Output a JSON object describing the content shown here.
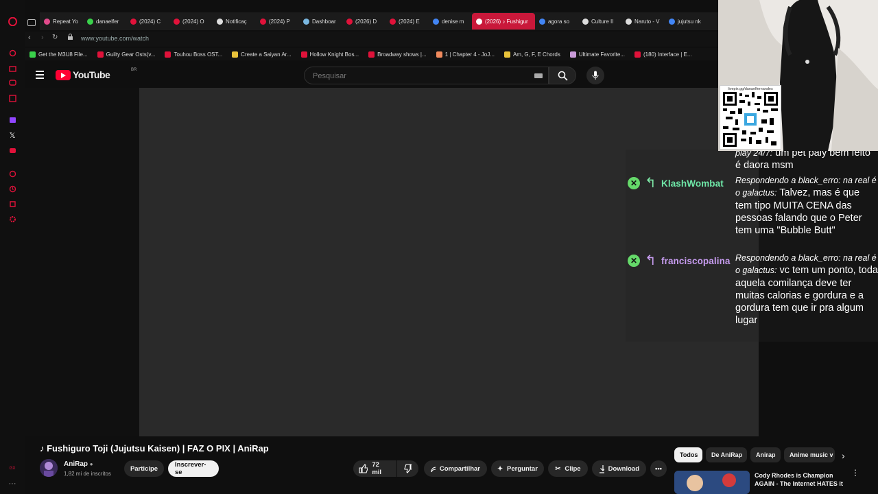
{
  "tabs": [
    {
      "label": "Repeat Yo",
      "color": "#e34b8c"
    },
    {
      "label": "danaelfer",
      "color": "#3ad14b"
    },
    {
      "label": "(2024) C",
      "color": "#e0123a"
    },
    {
      "label": "(2024) O",
      "color": "#e0123a"
    },
    {
      "label": "Notificaç",
      "color": "#dddddd"
    },
    {
      "label": "(2024) P",
      "color": "#e0123a"
    },
    {
      "label": "Dashboar",
      "color": "#7ab7e0"
    },
    {
      "label": "(2026) D",
      "color": "#e0123a"
    },
    {
      "label": "(2024) E",
      "color": "#e0123a"
    },
    {
      "label": "denise m",
      "color": "#4285f4"
    },
    {
      "label": "(2026) ♪ Fushigur",
      "color": "#ffffff",
      "active": true
    },
    {
      "label": "agora so",
      "color": "#4285f4"
    },
    {
      "label": "Culture II",
      "color": "#dddddd"
    },
    {
      "label": "Naruto - V",
      "color": "#dddddd"
    },
    {
      "label": "jujutsu nk",
      "color": "#4285f4"
    }
  ],
  "address": {
    "url": "www.youtube.com/watch"
  },
  "bookmarks": [
    {
      "label": "Get the M3U8 File...",
      "color": "#3ad14b"
    },
    {
      "label": "Guilty Gear Osts(v...",
      "color": "#e0123a"
    },
    {
      "label": "Touhou Boss OST...",
      "color": "#e0123a"
    },
    {
      "label": "Create a Saiyan Ar...",
      "color": "#e8c23a"
    },
    {
      "label": "Hollow Knight Bos...",
      "color": "#e0123a"
    },
    {
      "label": "Broadway shows |...",
      "color": "#e0123a"
    },
    {
      "label": "1 | Chapter 4 - JoJ...",
      "color": "#f08a5d"
    },
    {
      "label": "Am, G, F, E Chords",
      "color": "#e8c23a"
    },
    {
      "label": "Ultimate Favorite...",
      "color": "#c99ad8"
    },
    {
      "label": "(180) Interface | E...",
      "color": "#e0123a"
    }
  ],
  "youtube": {
    "logo_text": "YouTube",
    "country": "BR",
    "search_placeholder": "Pesquisar"
  },
  "chat": [
    {
      "username": "",
      "text": "um pet paly bem feito é daora msm",
      "ref": "play 24/7:"
    },
    {
      "username": "KlashWombat",
      "user_color": "#6ee6a7",
      "ref": "Respondendo a black_erro: na real é o galactus:",
      "text": "Talvez, mas é que tem tipo MUITA CENA das pessoas falando que o Peter tem uma \"Bubble Butt\""
    },
    {
      "username": "franciscopalina",
      "user_color": "#c79cf0",
      "ref": "Respondendo a black_erro: na real é o galactus:",
      "text": "vc tem um ponto, toda aquela comilança deve ter muitas calorias e gordura e a gordura tem que ir pra algum lugar"
    }
  ],
  "qr": {
    "label": "livepix.gg/danaelfernandes"
  },
  "video": {
    "title": "♪ Fushiguro Toji (Jujutsu Kaisen) | FAZ O PIX | AniRap",
    "channel": "AniRap",
    "subscribers": "1,82 mi de inscritos",
    "join_label": "Participe",
    "subscribe_label": "Inscrever-se",
    "likes": "72 mil",
    "share_label": "Compartilhar",
    "ask_label": "Perguntar",
    "clip_label": "Clipe",
    "download_label": "Download"
  },
  "chips": [
    "Todos",
    "De AniRap",
    "Anirap",
    "Anime music v"
  ],
  "related": {
    "title": "Cody Rhodes is Champion AGAIN - The Internet HATES it"
  }
}
